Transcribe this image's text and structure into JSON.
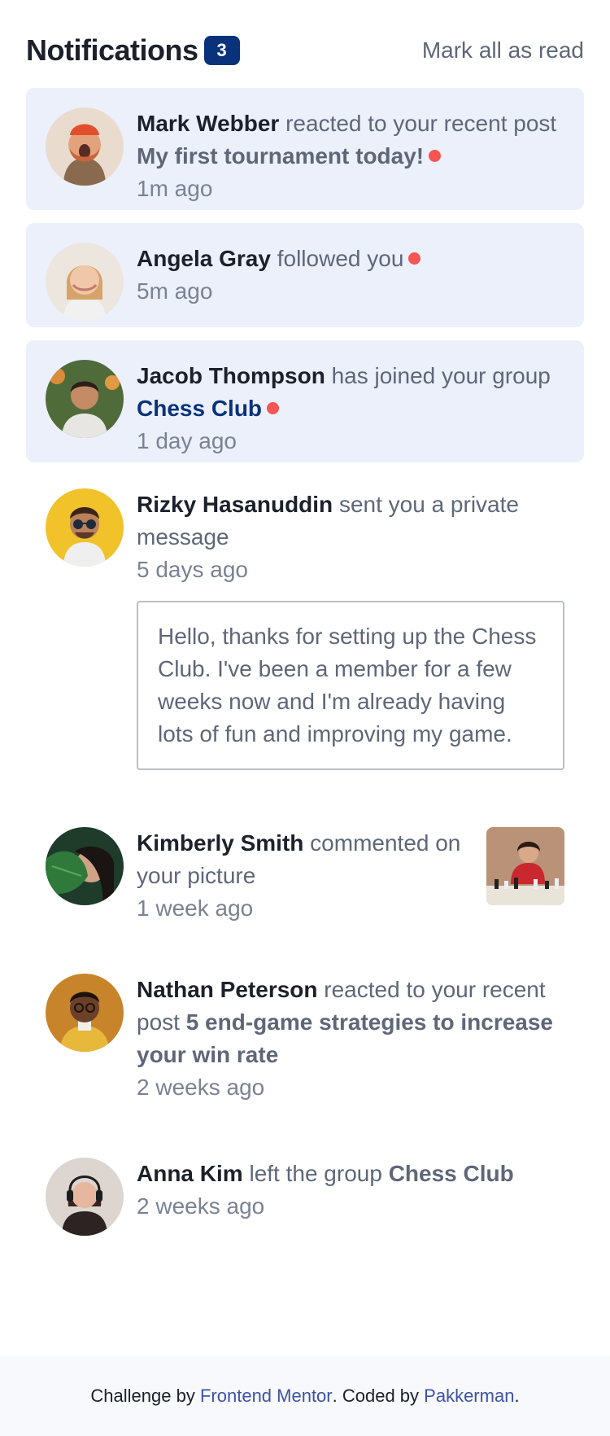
{
  "header": {
    "title": "Notifications",
    "unread_count": "3",
    "mark_all_label": "Mark all as read"
  },
  "notifications": [
    {
      "name": "Mark Webber",
      "action": " reacted to your recent post ",
      "post": "My first tournament today!",
      "time": "1m ago",
      "unread": true
    },
    {
      "name": "Angela Gray",
      "action": " followed you",
      "time": "5m ago",
      "unread": true
    },
    {
      "name": "Jacob Thompson",
      "action": " has joined your group ",
      "group": "Chess Club",
      "time": "1 day ago",
      "unread": true
    },
    {
      "name": "Rizky Hasanuddin",
      "action": " sent you a private message",
      "time": "5 days ago",
      "message": "Hello, thanks for setting up the Chess Club. I've been a member for a few weeks now and I'm already having lots of fun and improving my game.",
      "unread": false
    },
    {
      "name": "Kimberly Smith",
      "action": " commented on your picture",
      "time": "1 week ago",
      "unread": false
    },
    {
      "name": "Nathan Peterson",
      "action": " reacted to your recent post ",
      "post": "5 end-game strategies to increase your win rate",
      "time": "2 weeks ago",
      "unread": false
    },
    {
      "name": "Anna Kim",
      "action": " left the group ",
      "group": "Chess Club",
      "time": "2 weeks ago",
      "unread": false
    }
  ],
  "footer": {
    "prefix": "Challenge by ",
    "challenge_link": "Frontend Mentor",
    "middle": ". Coded by ",
    "author_link": "Pakkerman",
    "suffix": "."
  },
  "colors": {
    "accent": "#0a327b",
    "unread_bg": "#ebf0fb",
    "dot": "#f65552"
  }
}
